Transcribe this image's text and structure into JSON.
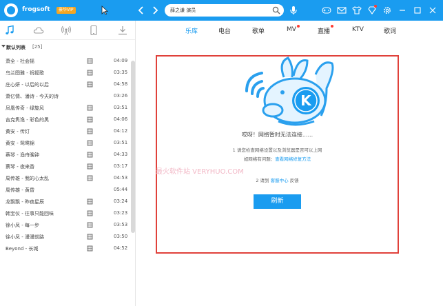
{
  "header": {
    "username": "frogsoft",
    "vip": "豪华VIP",
    "search": {
      "value": "薛之谦 演员"
    }
  },
  "sidebar": {
    "list_title": "默认列表",
    "list_count": "[25]",
    "songs": [
      {
        "title": "萧全 - 社会摇",
        "duration": "04:09"
      },
      {
        "title": "乌兰图雅 - 祝福歌",
        "duration": "03:35"
      },
      {
        "title": "庄心妍 - 以后的以后",
        "duration": "04:58"
      },
      {
        "title": "萧亿情、潘诗 - 今天的诗",
        "duration": "03:26"
      },
      {
        "title": "凤凰传奇 - 绿旋风",
        "duration": "03:51"
      },
      {
        "title": "吉克隽逸 - 彩色的黑",
        "duration": "04:06"
      },
      {
        "title": "黄安 - 传灯",
        "duration": "04:12"
      },
      {
        "title": "黄安 - 鸳鸯锦",
        "duration": "03:51"
      },
      {
        "title": "蔡琴 - 渔舟晚钟",
        "duration": "04:33"
      },
      {
        "title": "蔡琴 - 夜来香",
        "duration": "03:17"
      },
      {
        "title": "周传雄 - 我的心太乱",
        "duration": "04:53"
      },
      {
        "title": "周传雄 - 黄昏",
        "duration": "05:44"
      },
      {
        "title": "龙飘飘 - 昨夜星辰",
        "duration": "03:24"
      },
      {
        "title": "韩宝仪 - 往事只能回味",
        "duration": "03:23"
      },
      {
        "title": "徐小凤 - 每一步",
        "duration": "03:53"
      },
      {
        "title": "徐小凤 - 漫漫前路",
        "duration": "03:50"
      },
      {
        "title": "Beyond - 长城",
        "duration": "04:52"
      }
    ]
  },
  "main": {
    "tabs": [
      {
        "label": "乐库",
        "active": true
      },
      {
        "label": "电台"
      },
      {
        "label": "歌单"
      },
      {
        "label": "MV",
        "dot": true
      },
      {
        "label": "直播",
        "dot": true
      },
      {
        "label": "KTV"
      },
      {
        "label": "歌词"
      }
    ],
    "error": {
      "title": "哎呀！网络暂时无法连接......",
      "tip1": "1 请您检查网络设置以及浏览器是否可以上网",
      "tip2_prefix": "如网络有问题：",
      "tip2_link": "查看网络修复方法",
      "tip3_prefix": "2 请到",
      "tip3_link": "客服中心",
      "tip3_suffix": "反馈",
      "refresh_label": "刷新",
      "mascot_letter": "K"
    },
    "watermark": "最火软件站 VERYHUO.COM"
  },
  "colors": {
    "accent": "#1a9cf0",
    "highlight_border": "#e0413a",
    "badge": "#f5a623",
    "notification": "#ff3b30"
  }
}
